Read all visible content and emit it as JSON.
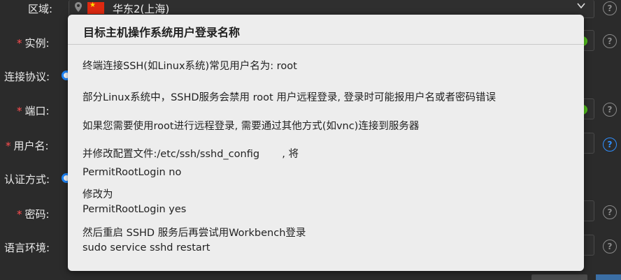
{
  "form": {
    "region_label": "区域:",
    "region_value": "华东2(上海)",
    "instance_label": "实例:",
    "protocol_label": "连接协议:",
    "port_label": "端口:",
    "username_label": "用户名:",
    "auth_label": "认证方式:",
    "password_label": "密码:",
    "locale_label": "语言环境:",
    "required_mark": "*",
    "help_glyph": "?"
  },
  "popover": {
    "title": "目标主机操作系统用户登录名称",
    "lines": [
      "终端连接SSH(如Linux系统)常见用户名为: root",
      "部分Linux系统中，SSHD服务会禁用 root 用户远程登录, 登录时可能报用户名或者密码错误",
      "如果您需要使用root进行远程登录, 需要通过其他方式(如vnc)连接到服务器",
      "并修改配置文件:/etc/ssh/sshd_config       , 将",
      "PermitRootLogin no",
      "修改为",
      "PermitRootLogin yes",
      "然后重启 SSHD 服务后再尝试用Workbench登录",
      "sudo service sshd restart"
    ]
  },
  "icons": {
    "help": "question-circle-icon",
    "pin": "map-pin-icon",
    "flag": "china-flag-icon",
    "chevron": "chevron-down-icon"
  },
  "colors": {
    "background": "#2b2b2b",
    "popover_bg": "#ededed",
    "required": "#ff4d4f",
    "radio_accent": "#1e88ff",
    "status_green": "#52c41a",
    "help_active": "#2f8fff"
  }
}
